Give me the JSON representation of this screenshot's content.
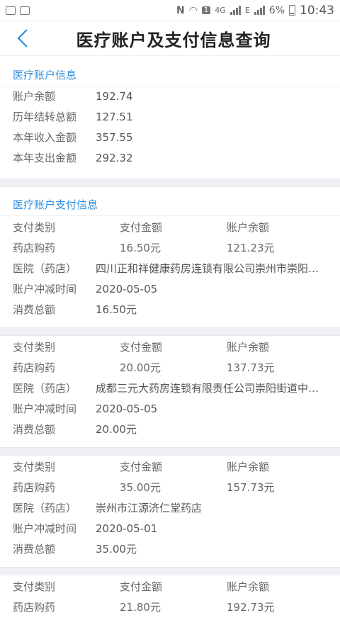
{
  "status": {
    "time": "10:43",
    "battery": "6%",
    "net1": "4G",
    "net2": "E"
  },
  "header": {
    "title": "医疗账户及支付信息查询"
  },
  "account": {
    "section_title": "医疗账户信息",
    "rows": [
      {
        "label": "账户余额",
        "value": "192.74"
      },
      {
        "label": "历年结转总额",
        "value": "127.51"
      },
      {
        "label": "本年收入金额",
        "value": "357.55"
      },
      {
        "label": "本年支出金额",
        "value": "292.32"
      }
    ]
  },
  "payments": {
    "section_title": "医疗账户支付信息",
    "labels": {
      "type": "支付类别",
      "amount": "支付金额",
      "balance": "账户余额",
      "hospital": "医院（药店）",
      "time": "账户冲减时间",
      "total": "消费总额"
    },
    "records": [
      {
        "type": "药店购药",
        "amount": "16.50元",
        "balance": "121.23元",
        "hospital": "四川正和祥健康药房连锁有限公司崇州市崇阳…",
        "time": "2020-05-05",
        "total": "16.50元"
      },
      {
        "type": "药店购药",
        "amount": "20.00元",
        "balance": "137.73元",
        "hospital": "成都三元大药房连锁有限责任公司崇阳街道中…",
        "time": "2020-05-05",
        "total": "20.00元"
      },
      {
        "type": "药店购药",
        "amount": "35.00元",
        "balance": "157.73元",
        "hospital": "崇州市江源济仁堂药店",
        "time": "2020-05-01",
        "total": "35.00元"
      },
      {
        "type": "药店购药",
        "amount": "21.80元",
        "balance": "192.73元",
        "hospital": "",
        "time": "",
        "total": ""
      }
    ]
  }
}
